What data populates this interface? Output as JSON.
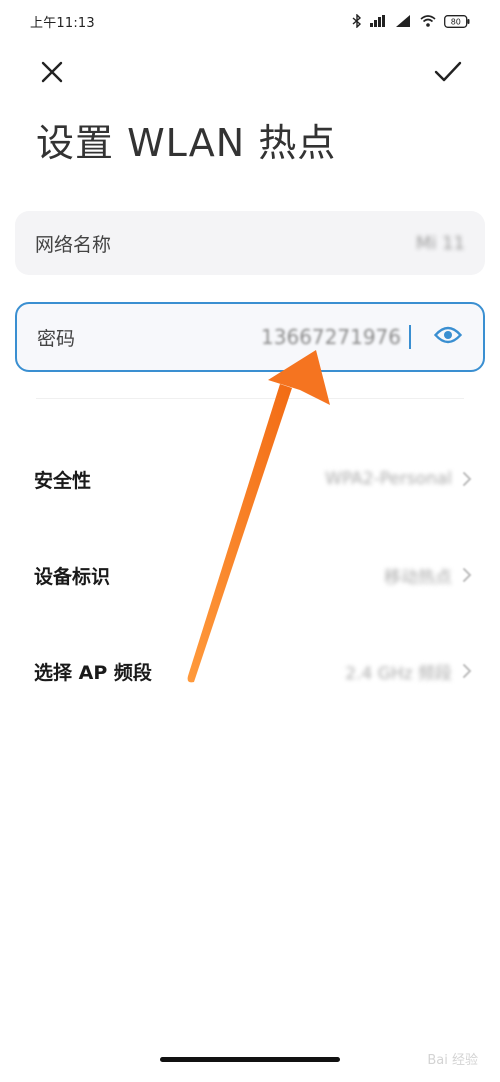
{
  "status_bar": {
    "time": "上午11:13",
    "battery": "80"
  },
  "header": {
    "title": "设置 WLAN 热点"
  },
  "fields": {
    "ssid": {
      "label": "网络名称",
      "value": "Mi 11"
    },
    "password": {
      "label": "密码",
      "value": "13667271976"
    }
  },
  "settings": [
    {
      "label": "安全性",
      "value": "WPA2-Personal"
    },
    {
      "label": "设备标识",
      "value": "移动热点"
    },
    {
      "label": "选择 AP 频段",
      "value": "2.4 GHz 频段"
    }
  ],
  "watermark": "Bai 经验",
  "colors": {
    "accent": "#3a8fd1",
    "arrow": "#f47b20"
  },
  "icons": {
    "close": "close-icon",
    "confirm": "checkmark-icon",
    "visibility": "eye-icon",
    "chevron": "chevron-right-icon"
  }
}
